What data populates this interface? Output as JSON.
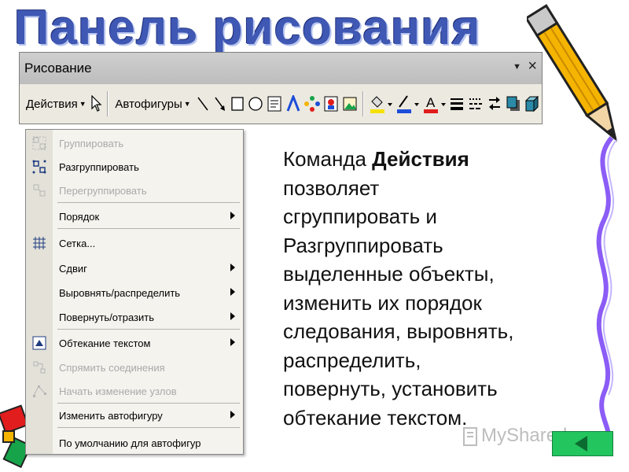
{
  "slide": {
    "title": "Панель рисования"
  },
  "toolbar": {
    "title": "Рисование",
    "dropdown_symbol": "▼",
    "close_symbol": "×",
    "actions_label": "Действия",
    "autoshapes_label": "Автофигуры",
    "colors": {
      "fill": "#f5e000",
      "line": "#1d4ed8",
      "font": "#e11d1d"
    }
  },
  "menu": {
    "items": [
      {
        "label": "Группировать",
        "enabled": false,
        "submenu": false,
        "icon": "group-icon"
      },
      {
        "label": "Разгруппировать",
        "enabled": true,
        "submenu": false,
        "icon": "ungroup-icon"
      },
      {
        "label": "Перегруппировать",
        "enabled": false,
        "submenu": false,
        "icon": "regroup-icon"
      },
      {
        "label": "Порядок",
        "enabled": true,
        "submenu": true,
        "icon": ""
      },
      {
        "label": "Сетка...",
        "enabled": true,
        "submenu": false,
        "icon": "grid-icon"
      },
      {
        "label": "Сдвиг",
        "enabled": true,
        "submenu": true,
        "icon": ""
      },
      {
        "label": "Выровнять/распределить",
        "enabled": true,
        "submenu": true,
        "icon": ""
      },
      {
        "label": "Повернуть/отразить",
        "enabled": true,
        "submenu": true,
        "icon": ""
      },
      {
        "label": "Обтекание текстом",
        "enabled": true,
        "submenu": true,
        "icon": "text-wrap-icon"
      },
      {
        "label": "Спрямить соединения",
        "enabled": false,
        "submenu": false,
        "icon": "straighten-connector-icon"
      },
      {
        "label": "Начать изменение узлов",
        "enabled": false,
        "submenu": false,
        "icon": "edit-points-icon"
      },
      {
        "label": "Изменить автофигуру",
        "enabled": true,
        "submenu": true,
        "icon": ""
      },
      {
        "label": "По умолчанию для автофигур",
        "enabled": true,
        "submenu": false,
        "icon": ""
      }
    ]
  },
  "description": {
    "prefix": "Команда ",
    "bold": "Действия",
    "lines": [
      "позволяет",
      "сгруппировать и",
      "Разгруппировать",
      "выделенные объекты,",
      "изменить их порядок",
      "следования, выровнять,",
      "распределить,",
      "повернуть, установить",
      "обтекание текстом."
    ]
  },
  "watermark": {
    "text": "MyShared"
  }
}
